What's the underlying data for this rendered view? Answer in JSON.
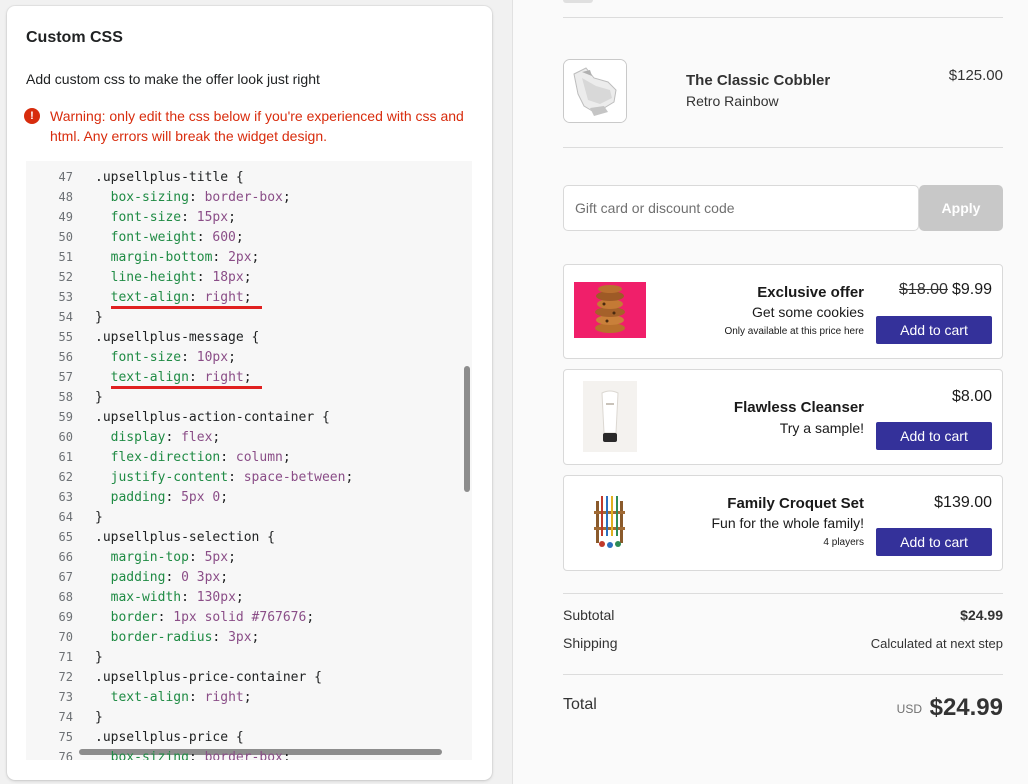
{
  "left": {
    "title": "Custom CSS",
    "description": "Add custom css to make the offer look just right",
    "warning": "Warning: only edit the css below if you're experienced with css and html. Any errors will break the widget design.",
    "warning_icon": "!",
    "code_lines": [
      {
        "n": "47",
        "text": ".upsellplus-title {"
      },
      {
        "n": "48",
        "text": "  box-sizing: border-box;"
      },
      {
        "n": "49",
        "text": "  font-size: 15px;"
      },
      {
        "n": "50",
        "text": "  font-weight: 600;"
      },
      {
        "n": "51",
        "text": "  margin-bottom: 2px;"
      },
      {
        "n": "52",
        "text": "  line-height: 18px;"
      },
      {
        "n": "53",
        "text": "  text-align: right;",
        "underline": true
      },
      {
        "n": "54",
        "text": "}"
      },
      {
        "n": "55",
        "text": ".upsellplus-message {"
      },
      {
        "n": "56",
        "text": "  font-size: 10px;"
      },
      {
        "n": "57",
        "text": "  text-align: right;",
        "underline": true
      },
      {
        "n": "58",
        "text": "}"
      },
      {
        "n": "59",
        "text": ".upsellplus-action-container {"
      },
      {
        "n": "60",
        "text": "  display: flex;"
      },
      {
        "n": "61",
        "text": "  flex-direction: column;"
      },
      {
        "n": "62",
        "text": "  justify-content: space-between;"
      },
      {
        "n": "63",
        "text": "  padding: 5px 0;"
      },
      {
        "n": "64",
        "text": "}"
      },
      {
        "n": "65",
        "text": ".upsellplus-selection {"
      },
      {
        "n": "66",
        "text": "  margin-top: 5px;"
      },
      {
        "n": "67",
        "text": "  padding: 0 3px;"
      },
      {
        "n": "68",
        "text": "  max-width: 130px;"
      },
      {
        "n": "69",
        "text": "  border: 1px solid #767676;"
      },
      {
        "n": "70",
        "text": "  border-radius: 3px;"
      },
      {
        "n": "71",
        "text": "}"
      },
      {
        "n": "72",
        "text": ".upsellplus-price-container {"
      },
      {
        "n": "73",
        "text": "  text-align: right;"
      },
      {
        "n": "74",
        "text": "}"
      },
      {
        "n": "75",
        "text": ".upsellplus-price {"
      },
      {
        "n": "76",
        "text": "  box-sizing: border-box;"
      }
    ]
  },
  "right": {
    "product": {
      "name": "The Classic Cobbler",
      "variant": "Retro Rainbow",
      "price": "$125.00"
    },
    "discount": {
      "placeholder": "Gift card or discount code",
      "apply_label": "Apply"
    },
    "offers": [
      {
        "title": "Exclusive offer",
        "message": "Get some cookies",
        "note": "Only available at this price here",
        "old_price": "$18.00",
        "price": "$9.99",
        "button": "Add to cart"
      },
      {
        "title": "Flawless Cleanser",
        "message": "Try a sample!",
        "note": "",
        "old_price": "",
        "price": "$8.00",
        "button": "Add to cart"
      },
      {
        "title": "Family Croquet Set",
        "message": "Fun for the whole family!",
        "note": "4 players",
        "old_price": "",
        "price": "$139.00",
        "button": "Add to cart"
      }
    ],
    "summary": {
      "subtotal_label": "Subtotal",
      "subtotal_value": "$24.99",
      "shipping_label": "Shipping",
      "shipping_value": "Calculated at next step",
      "total_label": "Total",
      "currency": "USD",
      "total_value": "$24.99"
    },
    "colors": {
      "accent_button": "#34319a",
      "warning": "#d82c0d",
      "apply_disabled": "#c8c8c8"
    }
  }
}
